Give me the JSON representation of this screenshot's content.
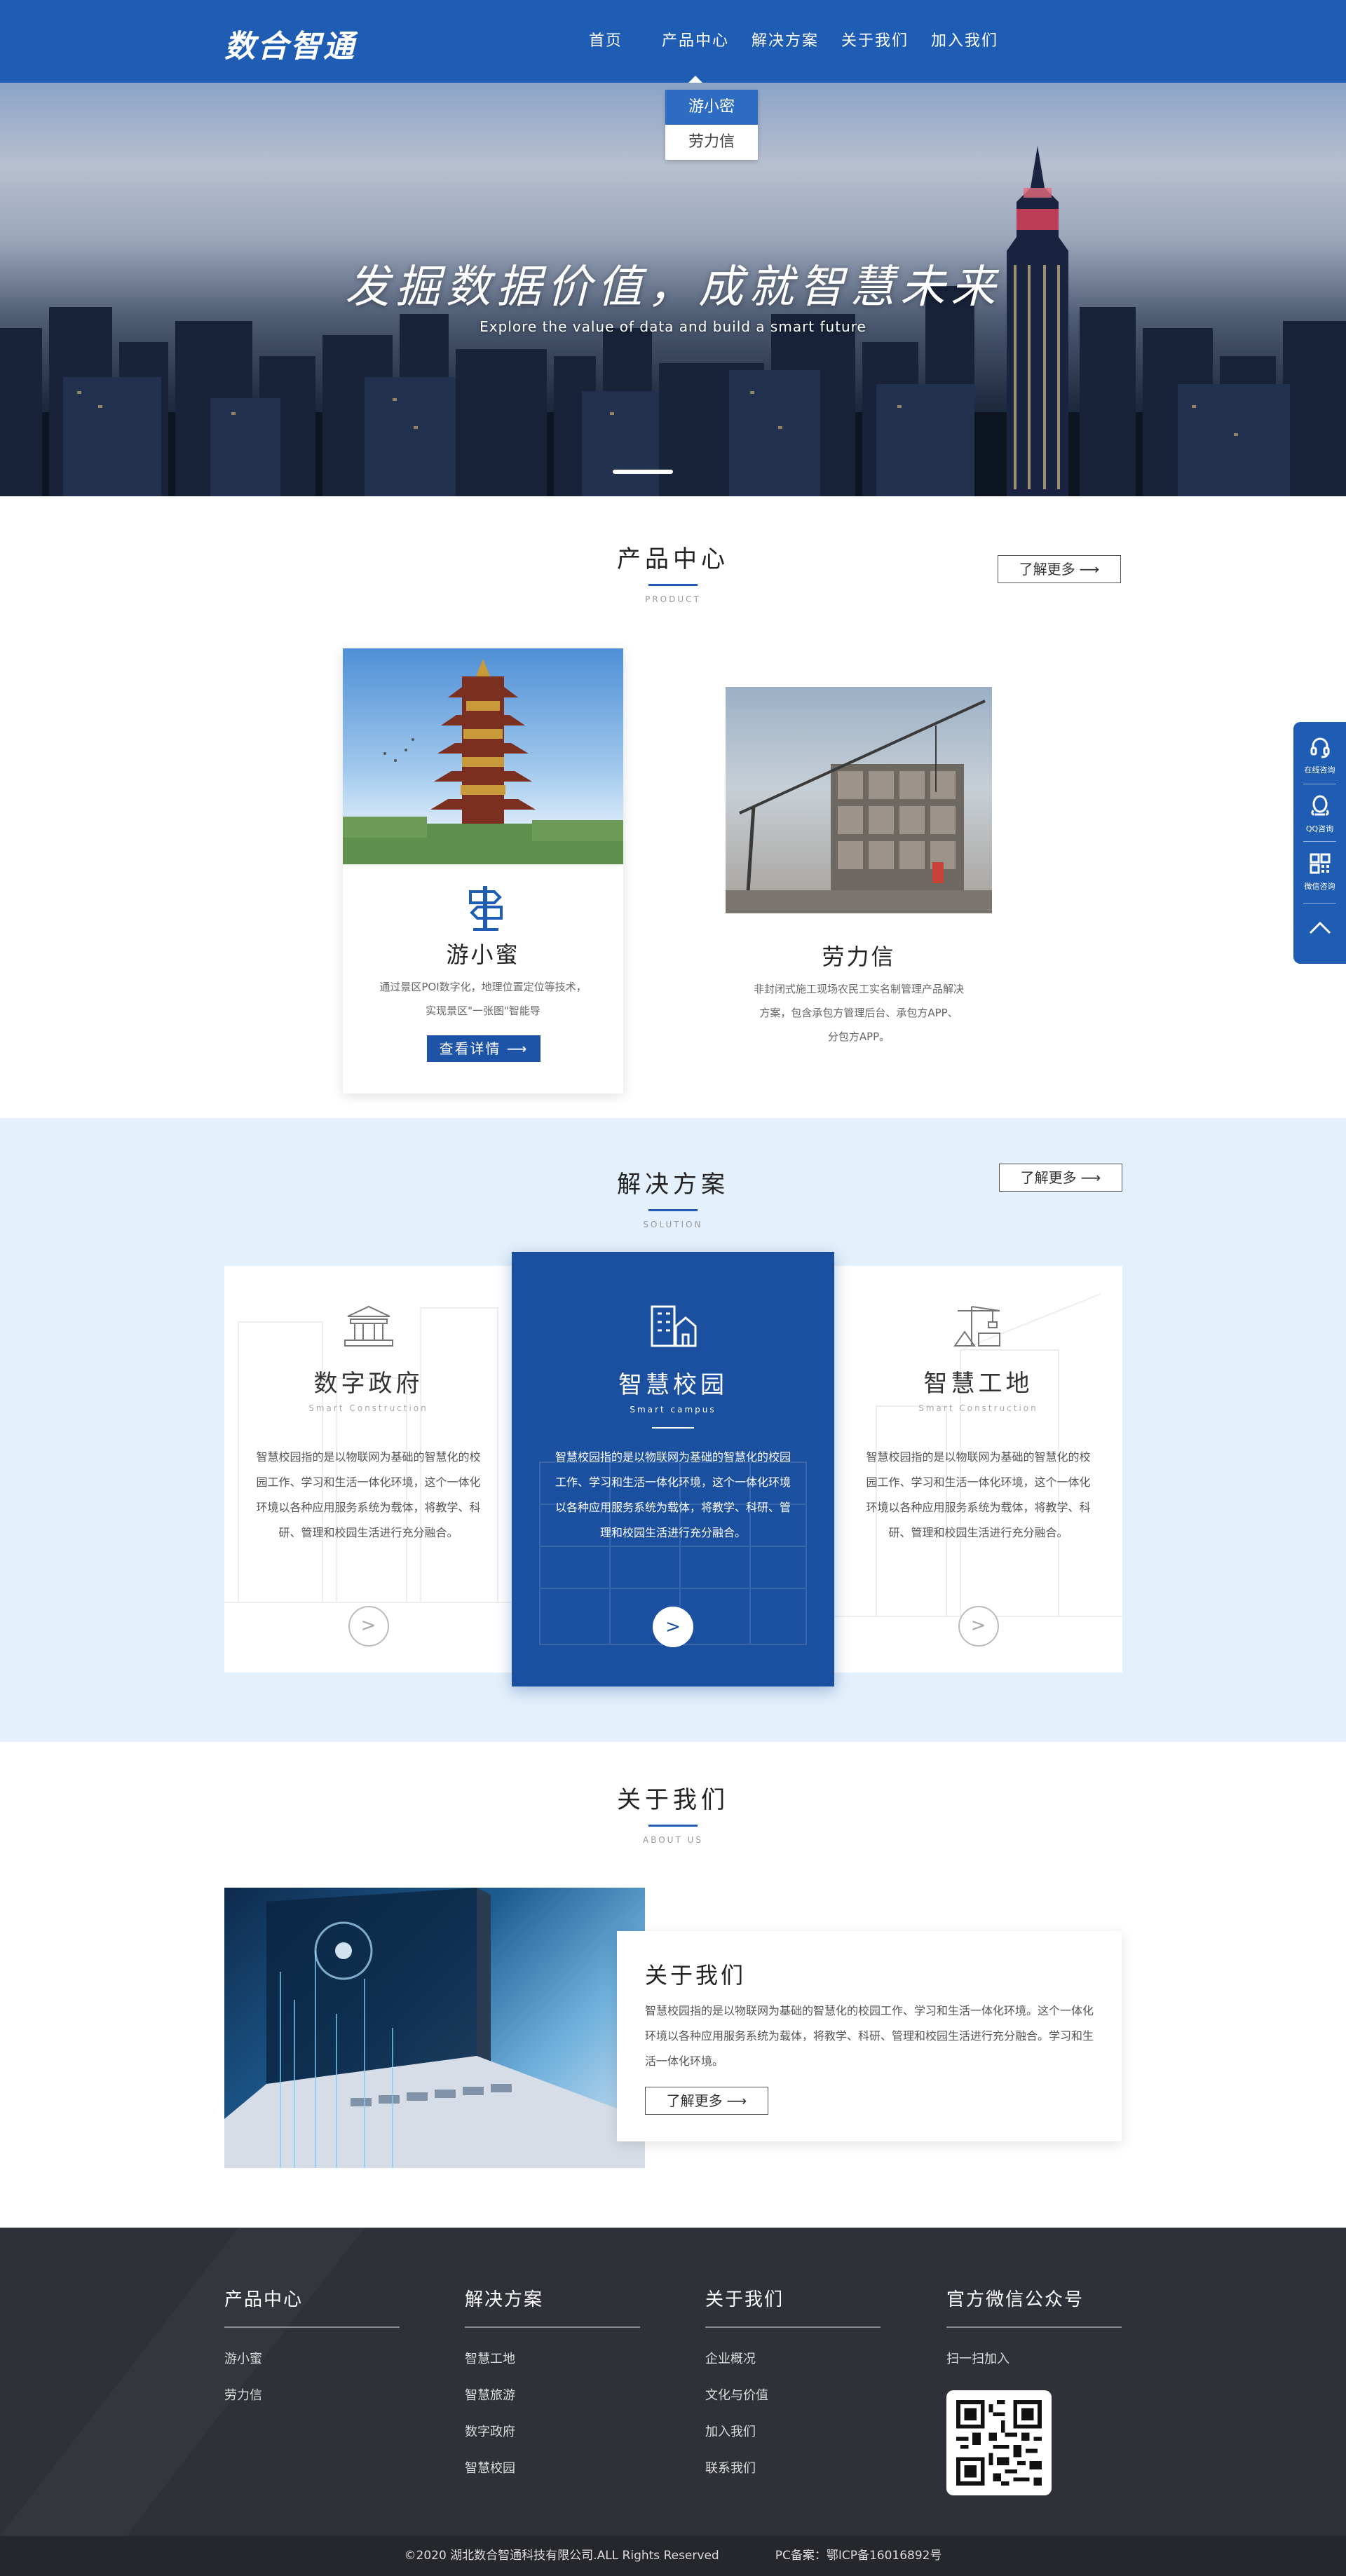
{
  "brand": {
    "logo": "数合智通"
  },
  "nav": {
    "items": [
      {
        "label": "首页"
      },
      {
        "label": "产品中心"
      },
      {
        "label": "解决方案"
      },
      {
        "label": "关于我们"
      },
      {
        "label": "加入我们"
      }
    ],
    "dropdown": [
      {
        "label": "游小密"
      },
      {
        "label": "劳力信"
      }
    ]
  },
  "hero": {
    "title": "发掘数据价值，成就智慧未来",
    "subtitle": "Explore the value of data and build a smart future"
  },
  "products": {
    "title": "产品中心",
    "title_en": "PRODUCT",
    "more_label": "了解更多",
    "items": [
      {
        "name": "游小蜜",
        "desc_line1": "通过景区POI数字化，地理位置定位等技术，",
        "desc_line2": "实现景区\"一张图\"智能导",
        "button": "查看详情"
      },
      {
        "name": "劳力信",
        "desc_line1": "非封闭式施工现场农民工实名制管理产品解决",
        "desc_line2": "方案，包含承包方管理后台、承包方APP、",
        "desc_line3": "分包方APP。"
      }
    ]
  },
  "solutions": {
    "title": "解决方案",
    "title_en": "SOLUTION",
    "more_label": "了解更多",
    "cards": [
      {
        "name": "数字政府",
        "name_en": "Smart Construction",
        "desc": "智慧校园指的是以物联网为基础的智慧化的校园工作、学习和生活一体化环境，这个一体化环境以各种应用服务系统为载体，将教学、科研、管理和校园生活进行充分融合。"
      },
      {
        "name": "智慧校园",
        "name_en": "Smart campus",
        "desc": "智慧校园指的是以物联网为基础的智慧化的校园工作、学习和生活一体化环境，这个一体化环境以各种应用服务系统为载体，将教学、科研、管理和校园生活进行充分融合。"
      },
      {
        "name": "智慧工地",
        "name_en": "Smart Construction",
        "desc": "智慧校园指的是以物联网为基础的智慧化的校园工作、学习和生活一体化环境，这个一体化环境以各种应用服务系统为载体，将教学、科研、管理和校园生活进行充分融合。"
      }
    ],
    "arrow_glyph": ">"
  },
  "about": {
    "title": "关于我们",
    "title_en": "ABOUT US",
    "box_title": "关于我们",
    "text": "智慧校园指的是以物联网为基础的智慧化的校园工作、学习和生活一体化环境。这个一体化环境以各种应用服务系统为载体，将教学、科研、管理和校园生活进行充分融合。学习和生活一体化环境。",
    "more_label": "了解更多"
  },
  "footer": {
    "columns": [
      {
        "title": "产品中心",
        "links": [
          "游小蜜",
          "劳力信"
        ]
      },
      {
        "title": "解决方案",
        "links": [
          "智慧工地",
          "智慧旅游",
          "数字政府",
          "智慧校园"
        ]
      },
      {
        "title": "关于我们",
        "links": [
          "企业概况",
          "文化与价值",
          "加入我们",
          "联系我们"
        ]
      },
      {
        "title": "官方微信公众号",
        "links": [
          "扫一扫加入"
        ]
      }
    ],
    "copyright": "©2020 湖北数合智通科技有限公司.ALL Rights Reserved",
    "icp": "PC备案：鄂ICP备16016892号"
  },
  "sidebar": {
    "items": [
      {
        "label": "在线咨询",
        "icon": "headset-icon"
      },
      {
        "label": "QQ咨询",
        "icon": "qq-icon"
      },
      {
        "label": "微信咨询",
        "icon": "qrcode-icon"
      },
      {
        "label": "",
        "icon": "back-to-top-icon"
      }
    ]
  },
  "colors": {
    "primary": "#1f5cb3",
    "primary_dark": "#1b4fa0",
    "solution_bg": "#e4f0fb",
    "footer_bg": "#2f3138",
    "copyright_bg": "#25272d"
  }
}
